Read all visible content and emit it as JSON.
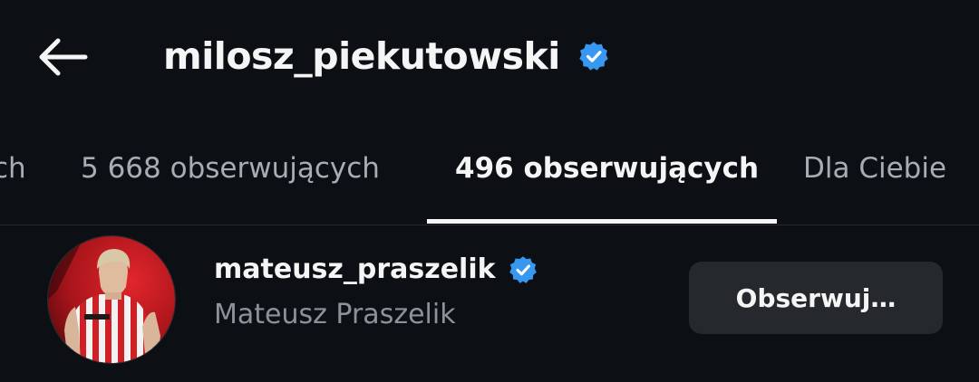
{
  "header": {
    "back_icon": "arrow-left-icon",
    "title": "milosz_piekutowski",
    "verified_icon": "verified-badge-icon"
  },
  "tabs": [
    {
      "label": "ch",
      "active": false
    },
    {
      "label": "5 668 obserwujących",
      "active": false
    },
    {
      "label": "496 obserwujących",
      "active": true
    },
    {
      "label": "Dla Ciebie",
      "active": false
    }
  ],
  "account": {
    "username": "mateusz_praszelik",
    "full_name": "Mateusz Praszelik",
    "verified_icon": "verified-badge-icon",
    "avatar_icon": "profile-photo",
    "follow_label": "Obserwuj…"
  },
  "colors": {
    "background": "#0c1014",
    "text_primary": "#f5f5f5",
    "text_secondary": "#8e9298",
    "tab_inactive": "#a8acb3",
    "verified_blue": "#3897f0",
    "button_bg": "#25292e"
  }
}
